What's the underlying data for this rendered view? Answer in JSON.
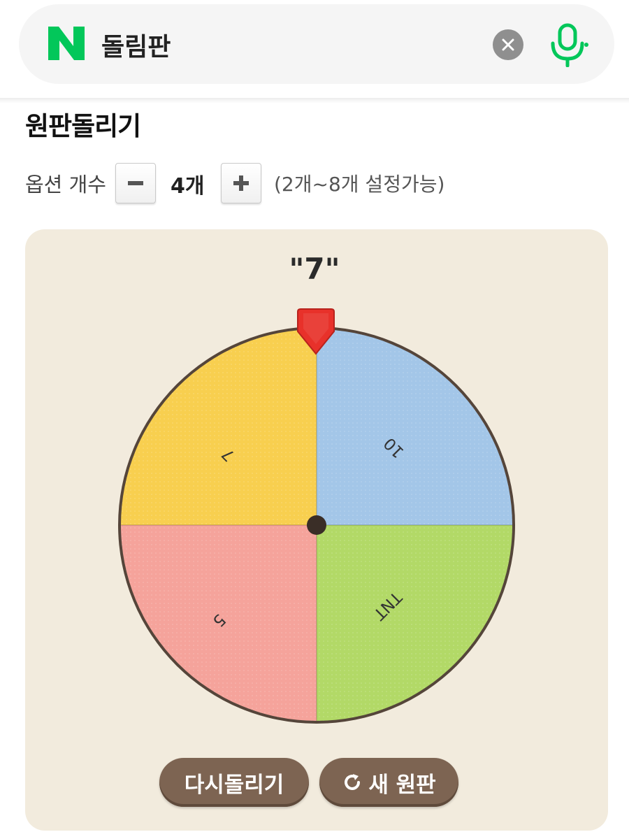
{
  "search": {
    "query": "돌림판",
    "logo_letter": "N",
    "brand_color": "#03c75a",
    "clear_icon": "close-icon",
    "mic_icon": "microphone-icon"
  },
  "section": {
    "title": "원판돌리기"
  },
  "options": {
    "label": "옵션 개수",
    "count": "4개",
    "range": "(2개~8개 설정가능)",
    "minus_icon": "minus-icon",
    "plus_icon": "plus-icon"
  },
  "wheel": {
    "result": "\"7\"",
    "segments": [
      {
        "label": "10",
        "color": "#a3c6e8"
      },
      {
        "label": "TNT",
        "color": "#b2d967"
      },
      {
        "label": "5",
        "color": "#f5a39b"
      },
      {
        "label": "7",
        "color": "#f8cf4f"
      }
    ],
    "pointer_color": "#e8312a",
    "rim_color": "#55453a"
  },
  "buttons": {
    "spin_again": "다시돌리기",
    "new_wheel": "새 원판",
    "new_wheel_icon": "refresh-icon"
  }
}
